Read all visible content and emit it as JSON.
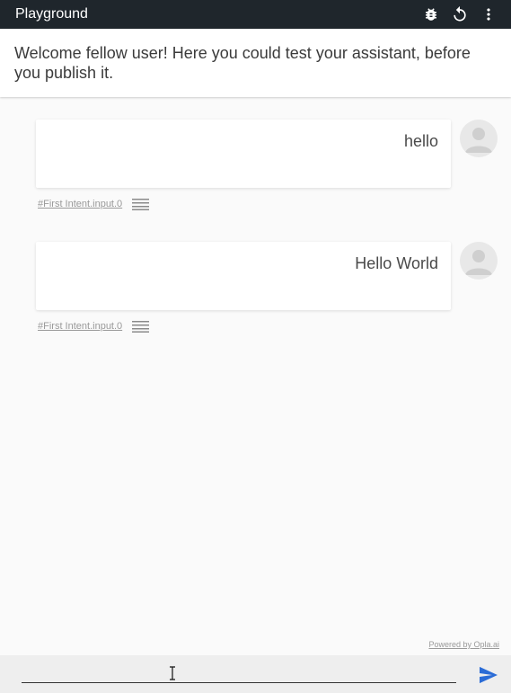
{
  "header": {
    "title": "Playground",
    "icons": [
      "bug-icon",
      "refresh-icon",
      "more-vert-icon"
    ]
  },
  "welcome": {
    "text": "Welcome fellow user! Here you could test your assistant, before you publish it."
  },
  "messages": [
    {
      "text": "hello",
      "intent": "#First Intent.input.0"
    },
    {
      "text": "Hello World",
      "intent": "#First Intent.input.0"
    }
  ],
  "footer": {
    "powered_by": "Powered by Opla.ai",
    "input_value": "",
    "input_placeholder": ""
  },
  "colors": {
    "topbar": "#1f262c",
    "send_accent": "#2b6cd6",
    "background": "#fafafa"
  }
}
